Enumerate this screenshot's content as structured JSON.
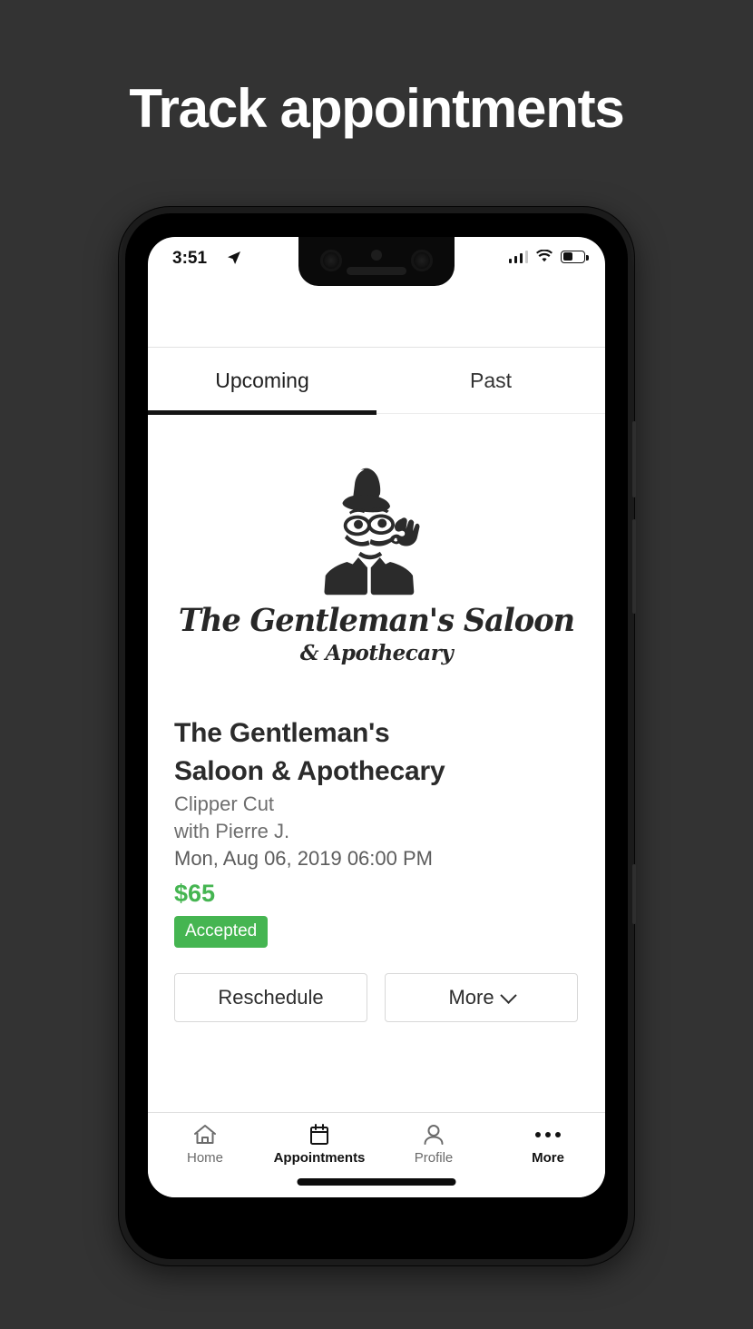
{
  "headline": "Track appointments",
  "status_bar": {
    "time": "3:51",
    "location_icon": "location-arrow-icon",
    "signal_icon": "cellular-signal-icon",
    "wifi_icon": "wifi-icon",
    "battery_icon": "battery-icon",
    "battery_level_percent": 40
  },
  "tabs": [
    {
      "label": "Upcoming",
      "active": true
    },
    {
      "label": "Past",
      "active": false
    }
  ],
  "logo": {
    "mascot_icon": "gentleman-mascot-icon",
    "name": "The Gentleman's Saloon",
    "subtitle": "& Apothecary"
  },
  "appointment": {
    "business_name": "The Gentleman's Saloon & Apothecary",
    "service": "Clipper Cut",
    "provider": "with Pierre J.",
    "datetime": "Mon, Aug 06, 2019 06:00 PM",
    "price": "$65",
    "status": "Accepted",
    "status_color": "#45b551",
    "price_color": "#45b551"
  },
  "actions": {
    "reschedule_label": "Reschedule",
    "more_label": "More",
    "more_chevron_icon": "chevron-down-icon"
  },
  "bottom_nav": [
    {
      "label": "Home",
      "icon": "home-icon",
      "active": false
    },
    {
      "label": "Appointments",
      "icon": "calendar-icon",
      "active": true
    },
    {
      "label": "Profile",
      "icon": "person-icon",
      "active": false
    },
    {
      "label": "More",
      "icon": "ellipsis-icon",
      "active": true
    }
  ],
  "theme": {
    "background": "#333333",
    "screen_background": "#ffffff",
    "accent_green": "#45b551",
    "text_dark": "#2b2b2b",
    "text_gray": "#6e6e6e"
  }
}
